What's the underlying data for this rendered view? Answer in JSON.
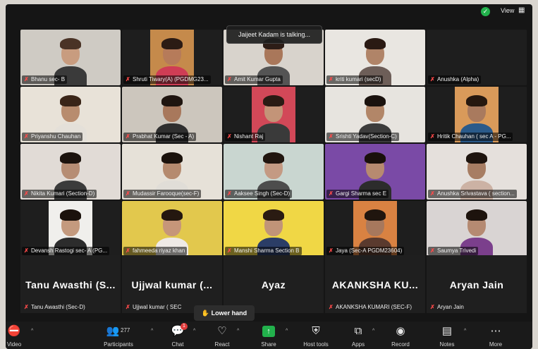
{
  "topbar": {
    "view_label": "View",
    "view_icon": "grid-icon",
    "shield_icon": "shield-check-icon"
  },
  "speaking_banner": "Jaijeet Kadam is talking...",
  "tiles": [
    {
      "label": "Bhanu sec- B",
      "colors": [
        "#cfcbc4",
        "#e3d2c3",
        "#c89c7f",
        "#4a3326",
        "#3a3a3a"
      ]
    },
    {
      "label": "Shruti Tiwary(A) (PGDMG23...",
      "colors": [
        "#1e1e1e",
        "#c58a4b",
        "#b67b5a",
        "#2b1b14",
        "#cf3d55"
      ]
    },
    {
      "label": "Amit Kumar Gupta",
      "colors": [
        "#d8d3cc",
        "#d9d2c8",
        "#a9775a",
        "#2d1d17",
        "#545454"
      ]
    },
    {
      "label": "kriti kumari (secD)",
      "colors": [
        "#e9e6e1",
        "#eeeae5",
        "#b08468",
        "#2a1a13",
        "#6d5e58"
      ]
    },
    {
      "label": "Anushka (Alpha)",
      "colors": [
        "#1e1e1e",
        "#1e1e1e",
        "#1e1e1e",
        "#1e1e1e",
        "#1e1e1e"
      ]
    },
    {
      "label": "Priyanshu Chauhan",
      "colors": [
        "#e8e2d8",
        "#ede8df",
        "#b88c6e",
        "#3a2518",
        "#e4e0d9"
      ]
    },
    {
      "label": "Prabhat Kumar (Sec - A)",
      "colors": [
        "#ccc6bd",
        "#d2cbc1",
        "#a8785c",
        "#1f1510",
        "#2f2f2f"
      ]
    },
    {
      "label": "Nishant Raj",
      "colors": [
        "#1e1e1e",
        "#d24858",
        "#c39478",
        "#2a1b14",
        "#3a3a3a"
      ]
    },
    {
      "label": "Srishti Yadav(Section-C)",
      "colors": [
        "#e7e4df",
        "#f0ece7",
        "#b28668",
        "#1a120e",
        "#3c3c3c"
      ]
    },
    {
      "label": "Hritik Chauhan ( sec A - PG...",
      "colors": [
        "#1e1e1e",
        "#d99a5a",
        "#a97a5e",
        "#26180f",
        "#2a5a8a"
      ]
    },
    {
      "label": "Nikita Kumari (Section-D)",
      "colors": [
        "#e1dbd6",
        "#e8e2de",
        "#b68d74",
        "#1c130e",
        "#3b3b3b"
      ]
    },
    {
      "label": "Mudassir Farooque(sec-F)",
      "colors": [
        "#e6e1d8",
        "#ede9e2",
        "#b58a6e",
        "#1b120c",
        "#e0ddd7"
      ]
    },
    {
      "label": "Aaksee Singh (Sec-D)",
      "colors": [
        "#c9d6d0",
        "#d3ddd8",
        "#c49a83",
        "#21160f",
        "#4d4d4d"
      ]
    },
    {
      "label": "Gargi Sharma sec E",
      "colors": [
        "#7a4aa6",
        "#8d5ab8",
        "#b78a70",
        "#1a100b",
        "#2c2c2c"
      ]
    },
    {
      "label": "Anushka Srivastava ( section...",
      "colors": [
        "#e5e0dc",
        "#ebe7e3",
        "#a77d63",
        "#1e140e",
        "#ccb2a4"
      ]
    },
    {
      "label": "Devansh Rastogi sec- A (PG...",
      "colors": [
        "#1e1e1e",
        "#f0efec",
        "#c49a7e",
        "#1b120c",
        "#2c2c2c"
      ]
    },
    {
      "label": "fahmeeda riyaz khan",
      "colors": [
        "#e2c84d",
        "#ead463",
        "#c69679",
        "#24170f",
        "#efeae6"
      ]
    },
    {
      "label": "Manshi Sharma Section B",
      "colors": [
        "#f0d745",
        "#f3dd55",
        "#c19478",
        "#2a1b12",
        "#2b3d66"
      ]
    },
    {
      "label": "Jaya (Sec-A PGDM23604)",
      "colors": [
        "#1e1e1e",
        "#d98242",
        "#a7785d",
        "#20150e",
        "#5a3a2e"
      ]
    },
    {
      "label": "Saumya Trivedi",
      "colors": [
        "#d9d4d3",
        "#e3dfde",
        "#b58a72",
        "#1d130d",
        "#7b3f8c"
      ]
    }
  ],
  "bottom_row": [
    {
      "display_name": "Tanu Awasthi (S...",
      "label": "Tanu Awasthi (Sec-D)"
    },
    {
      "display_name": "Ujjwal kumar (...",
      "label": "Ujjwal kumar ( SEC"
    },
    {
      "display_name": "Ayaz",
      "label": ""
    },
    {
      "display_name": "AKANKSHA KU...",
      "label": "AKANKSHA KUMARI (SEC-F)"
    },
    {
      "display_name": "Aryan Jain",
      "label": "Aryan Jain"
    }
  ],
  "lower_hand": "Lower hand",
  "toolbar": {
    "video": "Video",
    "participants": "Participants",
    "participants_count": "277",
    "chat": "Chat",
    "chat_badge": "1",
    "react": "React",
    "share": "Share",
    "host_tools": "Host tools",
    "apps": "Apps",
    "record": "Record",
    "notes": "Notes",
    "more": "More"
  }
}
